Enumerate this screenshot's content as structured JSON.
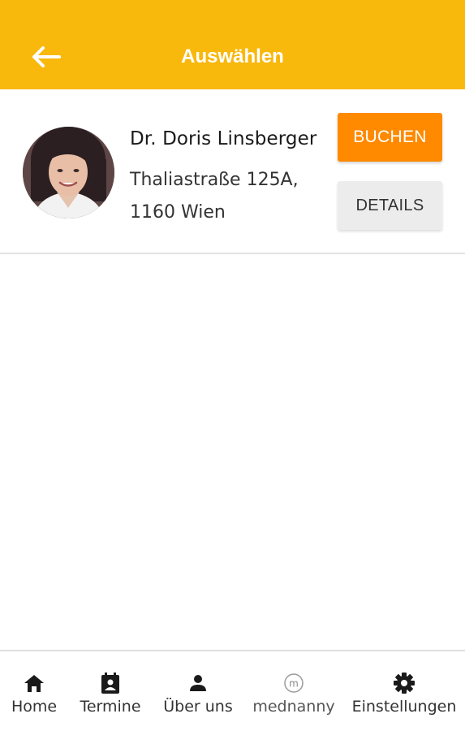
{
  "header": {
    "title": "Auswählen",
    "back_icon": "arrow-left-icon",
    "bg_color": "#F8B80C"
  },
  "doctor": {
    "name": "Dr. Doris Linsberger",
    "address_line1": "Thaliastraße 125A,",
    "address_line2": "1160 Wien",
    "book_label": "BUCHEN",
    "details_label": "DETAILS",
    "book_color": "#FF8A00"
  },
  "bottom_nav": {
    "items": [
      {
        "label": "Home",
        "icon": "home-icon"
      },
      {
        "label": "Termine",
        "icon": "calendar-contact-icon"
      },
      {
        "label": "Über uns",
        "icon": "person-icon"
      },
      {
        "label": "mednanny",
        "icon": "mednanny-logo-icon"
      },
      {
        "label": "Einstellungen",
        "icon": "gear-icon"
      }
    ]
  }
}
